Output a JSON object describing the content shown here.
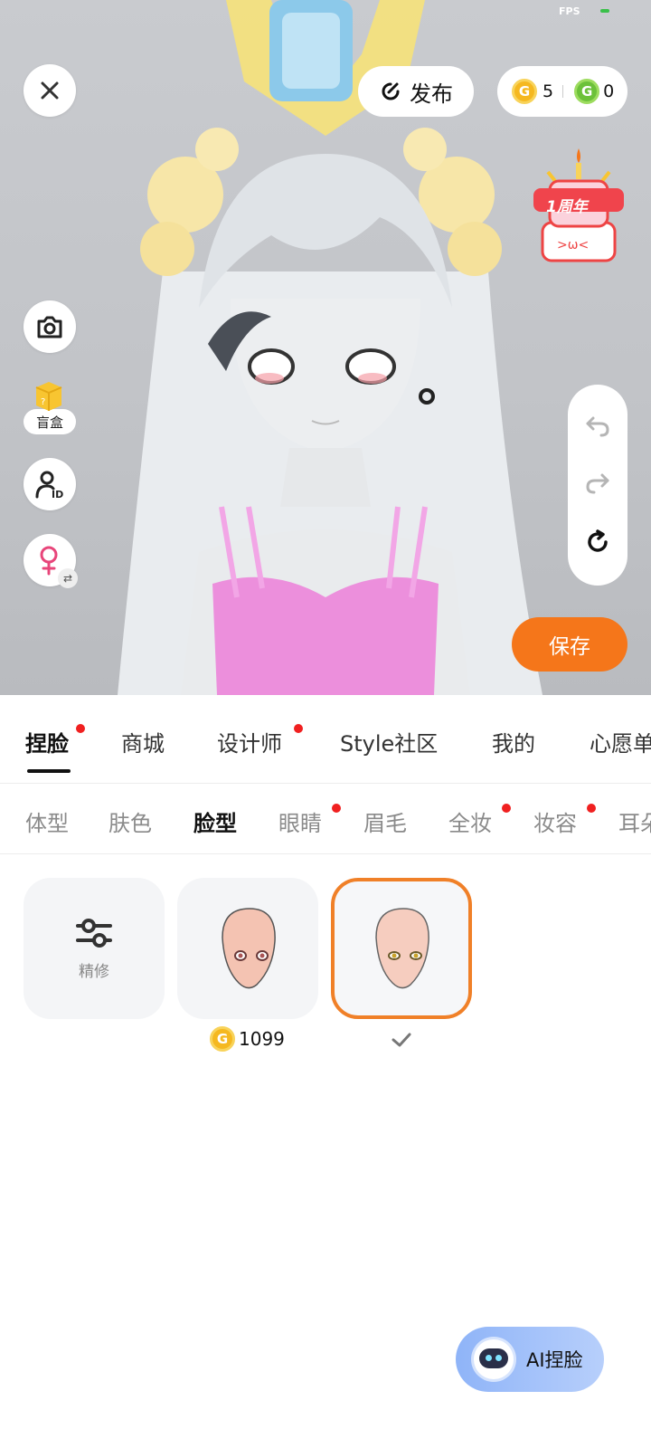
{
  "status": {
    "fps_label": "FPS"
  },
  "toolbar": {
    "publish_label": "发布",
    "gold_coins": "5",
    "green_coins": "0"
  },
  "side": {
    "blindbox_label": "盲盒"
  },
  "badge": {
    "anniversary_text": "1周年"
  },
  "actions": {
    "save_label": "保存"
  },
  "main_tabs": [
    {
      "label": "捏脸",
      "active": true,
      "dot": true
    },
    {
      "label": "商城",
      "active": false,
      "dot": false
    },
    {
      "label": "设计师",
      "active": false,
      "dot": true
    },
    {
      "label": "Style社区",
      "active": false,
      "dot": false
    },
    {
      "label": "我的",
      "active": false,
      "dot": false
    },
    {
      "label": "心愿单",
      "active": false,
      "dot": false
    }
  ],
  "sub_tabs": [
    {
      "label": "体型",
      "active": false,
      "dot": false
    },
    {
      "label": "肤色",
      "active": false,
      "dot": false
    },
    {
      "label": "脸型",
      "active": true,
      "dot": false
    },
    {
      "label": "眼睛",
      "active": false,
      "dot": true
    },
    {
      "label": "眉毛",
      "active": false,
      "dot": false
    },
    {
      "label": "全妆",
      "active": false,
      "dot": true
    },
    {
      "label": "妆容",
      "active": false,
      "dot": true
    },
    {
      "label": "耳朵",
      "active": false,
      "dot": false
    }
  ],
  "options": {
    "refine_label": "精修",
    "face_1_price": "1099",
    "selected_option": 2
  },
  "ai": {
    "label": "AI捏脸"
  },
  "colors": {
    "accent_orange": "#f5761a",
    "selection_border": "#f08028",
    "notification_dot": "#f02020",
    "coin_gold": "#f5b820",
    "coin_green": "#6cc13a"
  },
  "icons": [
    "close-icon",
    "publish-icon",
    "camera-icon",
    "blindbox-icon",
    "avatar-id-icon",
    "female-gender-icon",
    "undo-icon",
    "redo-icon",
    "reset-icon",
    "sliders-icon",
    "checkmark-icon",
    "robot-icon"
  ]
}
